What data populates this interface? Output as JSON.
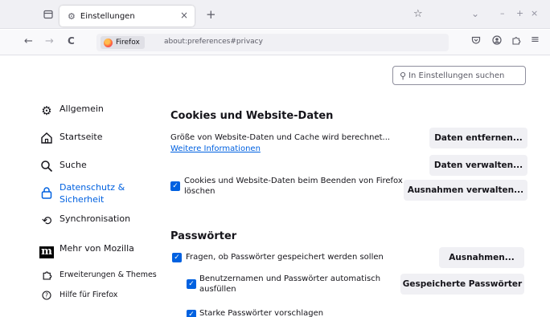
{
  "tab": {
    "title": "Einstellungen",
    "close": "×",
    "new_tab": "+"
  },
  "window": {
    "list_all_tabs": "⌄",
    "minimize": "–",
    "maximize": "+",
    "close": "×"
  },
  "nav": {
    "back": "←",
    "forward": "→",
    "reload": "C"
  },
  "urlbar": {
    "identity_label": "Firefox",
    "url": "about:preferences#privacy"
  },
  "search": {
    "placeholder": "In Einstellungen suchen"
  },
  "sidebar": {
    "items": [
      {
        "label": "Allgemein"
      },
      {
        "label": "Startseite"
      },
      {
        "label": "Suche"
      },
      {
        "label": "Datenschutz &",
        "label2": "Sicherheit"
      },
      {
        "label": "Synchronisation"
      },
      {
        "label": "Mehr von Mozilla"
      },
      {
        "label": "Erweiterungen & Themes"
      },
      {
        "label": "Hilfe für Firefox"
      }
    ]
  },
  "cookies": {
    "heading": "Cookies und Website-Daten",
    "size_text": "Größe von Website-Daten und Cache wird berechnet...",
    "more_info": "Weitere Informationen",
    "clear_button": "Daten entfernen...",
    "manage_button": "Daten verwalten...",
    "delete_on_close_line1": "Cookies und Website-Daten beim Beenden von Firefox",
    "delete_on_close_line2": "löschen",
    "exceptions_button": "Ausnahmen verwalten..."
  },
  "passwords": {
    "heading": "Passwörter",
    "ask_save": "Fragen, ob Passwörter gespeichert werden sollen",
    "exceptions_button": "Ausnahmen...",
    "autofill_line1": "Benutzernamen und Passwörter automatisch",
    "autofill_line2": "ausfüllen",
    "saved_button": "Gespeicherte Passwörter",
    "suggest_strong": "Starke Passwörter vorschlagen"
  },
  "colors": {
    "accent": "#0061e0",
    "toolbar": "#f0f0f4"
  }
}
